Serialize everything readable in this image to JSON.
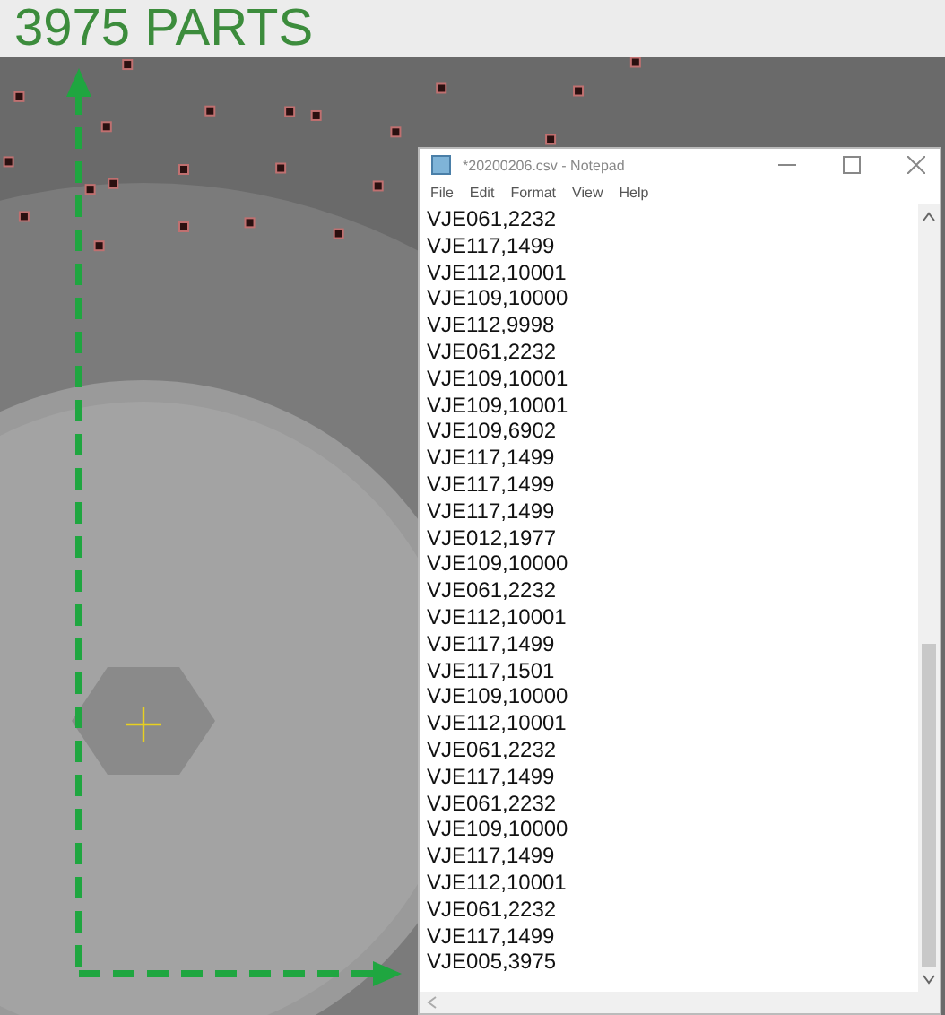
{
  "header": {
    "title": "3975 PARTS"
  },
  "notepad": {
    "title": "*20200206.csv - Notepad",
    "menu": [
      "File",
      "Edit",
      "Format",
      "View",
      "Help"
    ],
    "lines": [
      "VJE061,2232",
      "VJE117,1499",
      "VJE112,10001",
      "VJE109,10000",
      "VJE112,9998",
      "VJE061,2232",
      "VJE109,10001",
      "VJE109,10001",
      "VJE109,6902",
      "VJE117,1499",
      "VJE117,1499",
      "VJE117,1499",
      "VJE012,1977",
      "VJE109,10000",
      "VJE061,2232",
      "VJE112,10001",
      "VJE117,1499",
      "VJE117,1501",
      "VJE109,10000",
      "VJE112,10001",
      "VJE061,2232",
      "VJE117,1499",
      "VJE061,2232",
      "VJE109,10000",
      "VJE117,1499",
      "VJE112,10001",
      "VJE061,2232",
      "VJE117,1499",
      "VJE005,3975"
    ]
  }
}
